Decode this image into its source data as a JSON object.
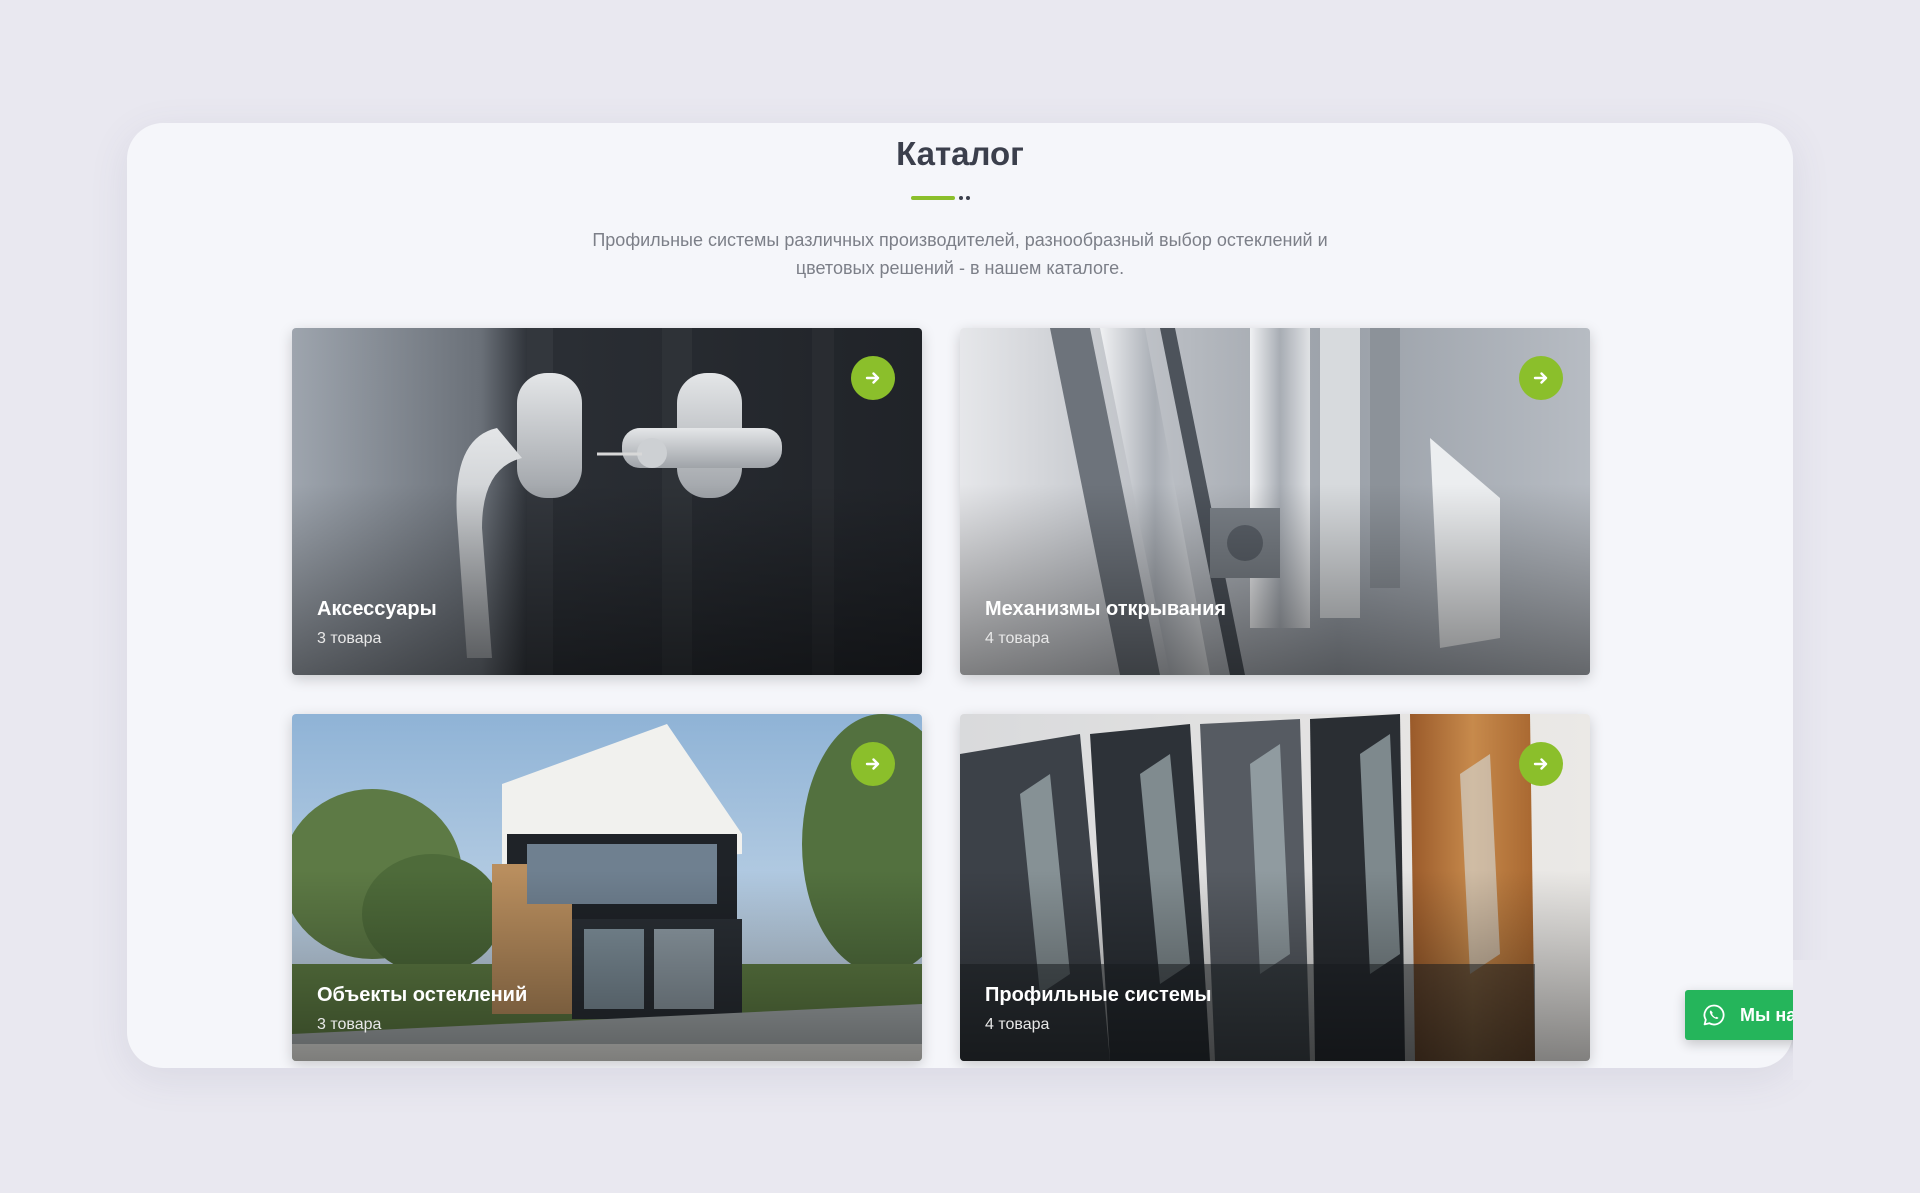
{
  "catalog": {
    "title": "Каталог",
    "description_line1": "Профильные системы различных производителей, разнообразный выбор остеклений и",
    "description_line2": "цветовых решений - в нашем каталоге."
  },
  "categories": [
    {
      "name": "Аксессуары",
      "count": "3 товара",
      "arrow_icon": "arrow-right-icon"
    },
    {
      "name": "Механизмы открывания",
      "count": "4 товара",
      "arrow_icon": "arrow-right-icon"
    },
    {
      "name": "Объекты остеклений",
      "count": "3 товара",
      "arrow_icon": "arrow-right-icon"
    },
    {
      "name": "Профильные системы",
      "count": "4 товара",
      "arrow_icon": "arrow-right-icon"
    }
  ],
  "chat_widget": {
    "label": "Мы на",
    "icon": "whatsapp-icon"
  },
  "colors": {
    "accent": "#8bbf2b",
    "chat": "#25b55b",
    "title": "#3b3f4c",
    "background": "#e9e8f0"
  }
}
